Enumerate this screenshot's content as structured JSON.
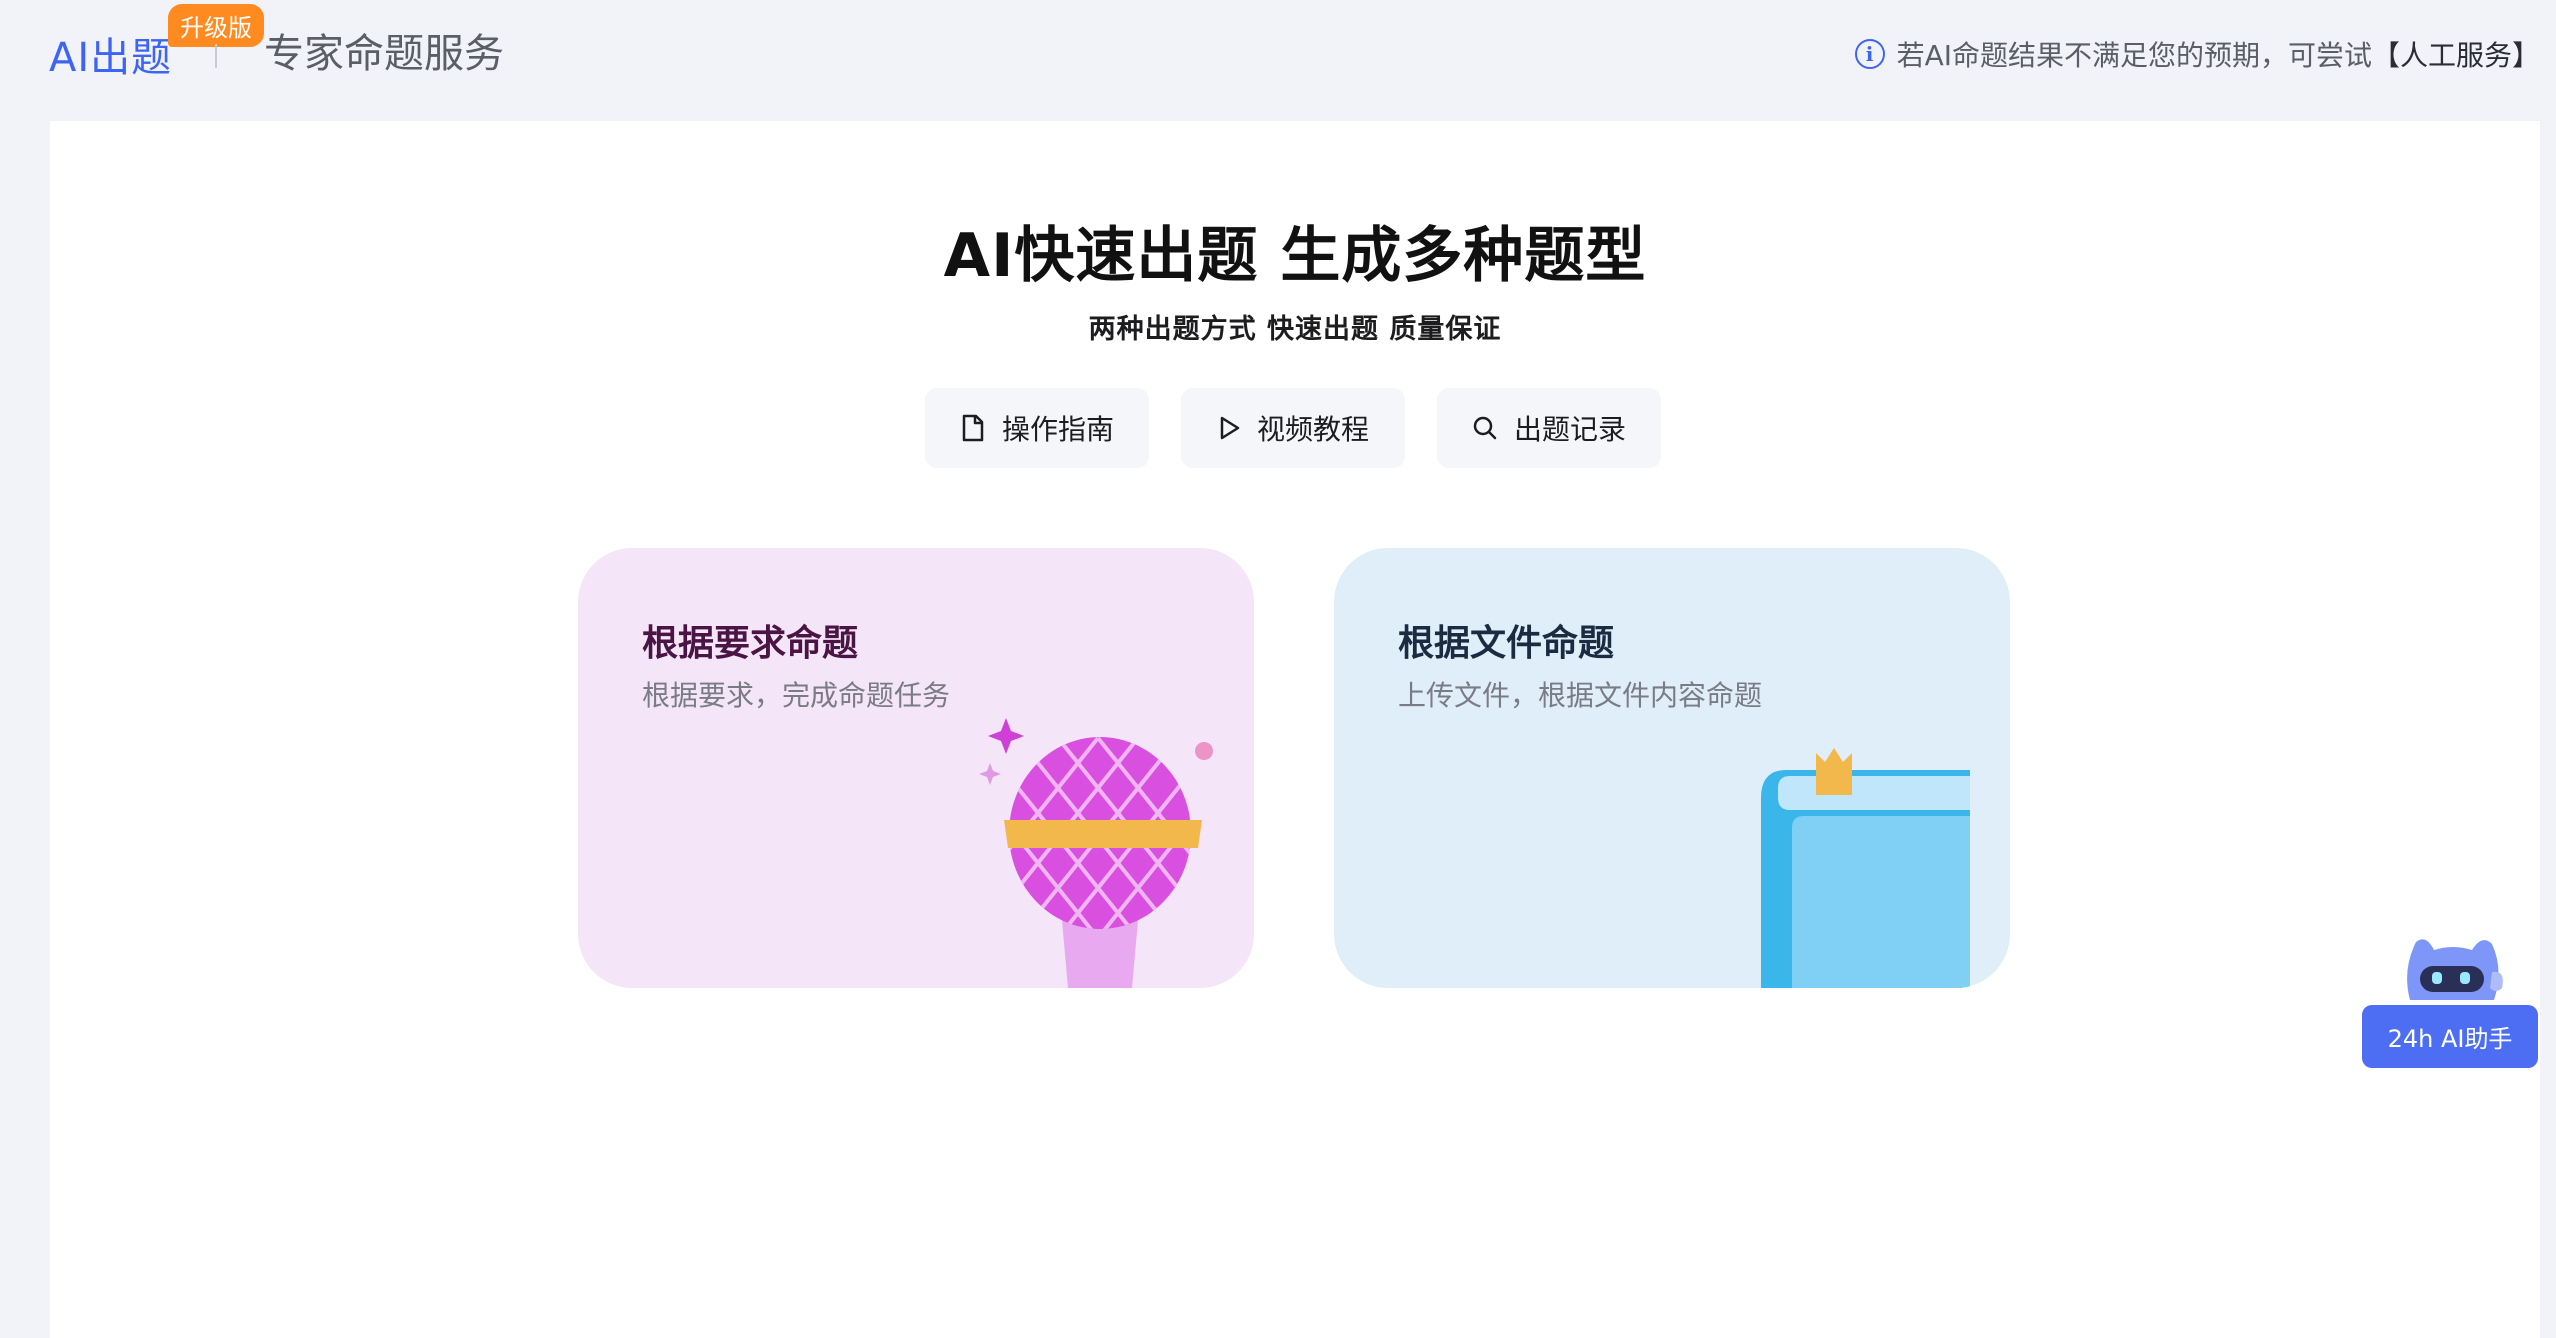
{
  "header": {
    "brand_title": "AI出题",
    "brand_badge": "升级版",
    "sub_title": "专家命题服务",
    "notice_text": "若AI命题结果不满足您的预期，可尝试",
    "notice_link": "【人工服务】"
  },
  "hero": {
    "title": "AI快速出题 生成多种题型",
    "subtitle": "两种出题方式 快速出题 质量保证"
  },
  "actions": [
    {
      "label": "操作指南",
      "icon": "document-icon"
    },
    {
      "label": "视频教程",
      "icon": "play-icon"
    },
    {
      "label": "出题记录",
      "icon": "search-icon"
    }
  ],
  "cards": [
    {
      "title": "根据要求命题",
      "desc": "根据要求，完成命题任务",
      "illustration": "microphone-illustration"
    },
    {
      "title": "根据文件命题",
      "desc": "上传文件，根据文件内容命题",
      "illustration": "book-illustration"
    }
  ],
  "assistant": {
    "label": "24h AI助手"
  },
  "colors": {
    "accent": "#3e64f4",
    "badge": "#ff8a1f",
    "card_req_bg": "#f5e5f8",
    "card_file_bg": "#e0eef9",
    "assistant_bg": "#4d6ef2"
  }
}
